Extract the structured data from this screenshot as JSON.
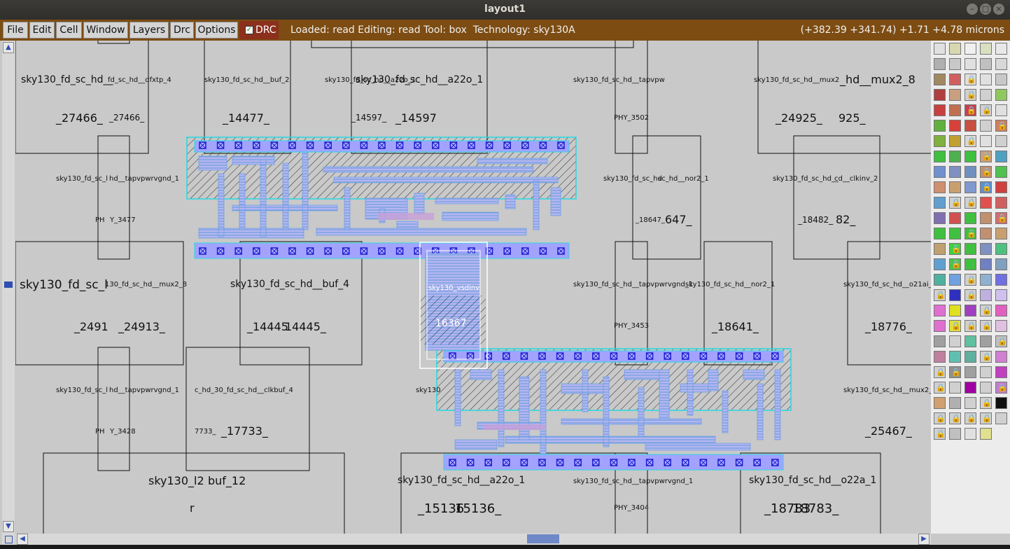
{
  "window": {
    "title": "layout1",
    "controls": [
      "–",
      "□",
      "×"
    ]
  },
  "menu": {
    "items": [
      "File",
      "Edit",
      "Cell",
      "Window",
      "Layers",
      "Drc",
      "Options"
    ],
    "drc_toggle": {
      "label": "DRC",
      "checked": true
    }
  },
  "status": {
    "text": "Loaded: read Editing: read Tool: box  Technology: sky130A",
    "coords": "(+382.39 +341.74) +1.71 +4.78 microns"
  },
  "selection": {
    "cell": "sky130_vsdinv",
    "instance": "16367"
  },
  "cell_labels": [
    "sky130_fd_sc_hd__",
    "fd_sc_hd__dfxtp_4",
    "sky130_fd_sc_hd__buf_2",
    "sky130_fd_sc_hd__a22o_1",
    "sky130_fd_sc_hd__a22o_1",
    "sky130_fd_sc_hd__tapvpw",
    "sky130_fd_sc_hd__mux2",
    "_hd__mux2_8",
    "_27466_",
    "_27466_",
    "_14477_",
    "_14597_",
    "_14597",
    "PHY_3502",
    "_24925_",
    "925_",
    "sky130_fd_sc_l",
    "hd__tapvpwrvgnd_1",
    "sky130_fd_sc_hd",
    "sc_hd__nor2_1",
    "sky130_fd_sc_hd__",
    "cd__clkinv_2",
    "PH",
    "Y_3477",
    "_18647_",
    "647_",
    "_18482_",
    "82_",
    "sky130_fd_sc_l",
    "130_fd_sc_hd__mux2_8",
    "sky130_fd_sc_hd__buf_4",
    "sky130_fd_sc_hd__tapvpwrvgnd_1",
    "sky130_fd_sc_hd__nor2_1",
    "sky130_fd_sc_hd__o21ai_",
    "_2491",
    "_24913_",
    "_14445",
    "14445_",
    "PHY_3453",
    "_18641_",
    "_18776_",
    "sky130_fd_sc_l",
    "hd__tapvpwrvgnd_1",
    "c_hd_30_fd_sc_hd__clkbuf_4",
    "sky130",
    "sky130_fd_sc_hd__mux2_",
    "PH",
    "Y_3428",
    "7733_",
    "_17733_",
    "_25467_",
    "sky130_l2",
    "buf_12",
    "sky130_fd_sc_hd__a22o_1",
    "sky130_fd_sc_hd__tapvpwrvgnd_1",
    "sky130_fd_sc_hd__o22a_1",
    "r",
    "_15136",
    "15136_",
    "PHY_3404",
    "_18783",
    "18783_"
  ],
  "colors": {
    "titlebar": "#2f2e2a",
    "menubar": "#7d4c12",
    "drc": "#8c2f1c",
    "canvas": "#c9c9c9",
    "metal1": "#a3a3ff",
    "locali": "#6e9fe0",
    "nwell": "#2a2a2a",
    "contact": "#1a1ad0",
    "boundary": "#27d8e3"
  },
  "icons": {
    "scroll_up": "up-arrow-icon",
    "scroll_down": "down-arrow-icon",
    "scroll_left": "left-arrow-icon",
    "scroll_right": "right-arrow-icon",
    "lock": "lock-icon",
    "checkbox": "check-icon"
  }
}
